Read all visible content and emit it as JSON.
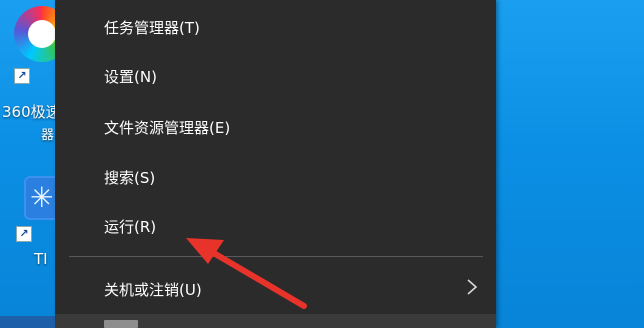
{
  "desktop": {
    "icons": [
      {
        "label": "360极速",
        "label_line2": "器",
        "icon": "360-browser-icon"
      },
      {
        "label": "TI",
        "icon": "ti-app-icon"
      }
    ]
  },
  "context_menu": {
    "items": [
      {
        "label": "任务管理器(T)"
      },
      {
        "label": "设置(N)"
      },
      {
        "label": "文件资源管理器(E)"
      },
      {
        "label": "搜索(S)"
      },
      {
        "label": "运行(R)"
      },
      {
        "label": "关机或注销(U)",
        "has_submenu": true,
        "submenu_icon": "chevron-right-icon"
      }
    ],
    "background": "#2b2b2b",
    "text_color": "#ffffff"
  },
  "annotation": {
    "type": "red-arrow",
    "points_to": "运行(R)",
    "color": "#e8332b"
  },
  "colors": {
    "desktop_blue": "#0b8fe4"
  }
}
